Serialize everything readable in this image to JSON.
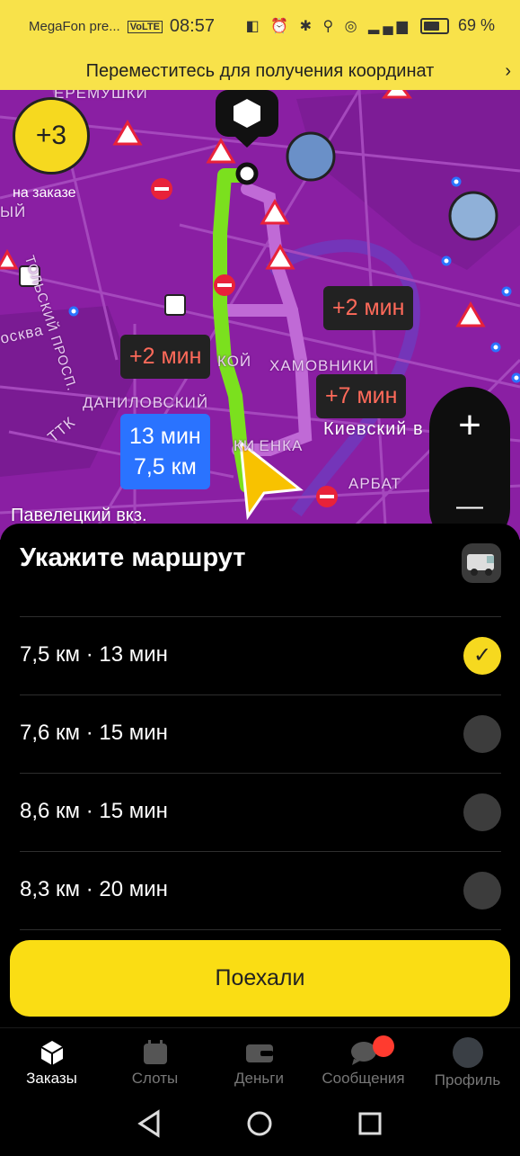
{
  "status_bar": {
    "carrier": "MegaFon pre...",
    "volte": "VoLTE",
    "time": "08:57",
    "battery": "69 %"
  },
  "notice": {
    "text": "Переместитесь для получения координат"
  },
  "map": {
    "labels": {
      "cheryomushki": "ЕРЁМУШКИ",
      "komsomolsky": "ТОЛЬСКИЙ ПРОСП.",
      "khamovniki": "ХАМОВНИКИ",
      "danilovsky": "ДАНИЛОВСКИЙ",
      "ttk": "ТТК",
      "moskva": "осква",
      "kievsky": "Киевский в",
      "arbat": "АРБАТ",
      "paveletsky": "Павелецкий вкз.",
      "ostozhenka": "КИ ЕНКА",
      "yy": "ЫЙ",
      "koy": "КОЙ"
    },
    "bubble_1": "+2 мин",
    "bubble_2": "+2 мин",
    "bubble_3": "+7 мин",
    "route_time": "13 мин",
    "route_distance": "7,5 км"
  },
  "bonus": {
    "value": "+3",
    "label": "на заказе"
  },
  "zoom": {
    "plus": "+",
    "minus": "—"
  },
  "sheet": {
    "title": "Укажите маршрут",
    "routes": [
      {
        "label": "7,5 км · 13 мин",
        "selected": true
      },
      {
        "label": "7,6 км · 15 мин",
        "selected": false
      },
      {
        "label": "8,6 км · 15 мин",
        "selected": false
      },
      {
        "label": "8,3 км · 20 мин",
        "selected": false
      }
    ],
    "check": "✓",
    "go_label": "Поехали"
  },
  "tabs": [
    {
      "label": "Заказы",
      "icon": "box-icon",
      "active": true
    },
    {
      "label": "Слоты",
      "icon": "calendar-icon",
      "active": false
    },
    {
      "label": "Деньги",
      "icon": "wallet-icon",
      "active": false
    },
    {
      "label": "Сообщения",
      "icon": "chat-icon",
      "active": false
    },
    {
      "label": "Профиль",
      "icon": "avatar-icon",
      "active": false
    }
  ],
  "colors": {
    "accent_yellow": "#FADD14",
    "map_purple": "#8A1FA3",
    "route_green": "#7BE01E",
    "badge_blue": "#2A73FF"
  }
}
